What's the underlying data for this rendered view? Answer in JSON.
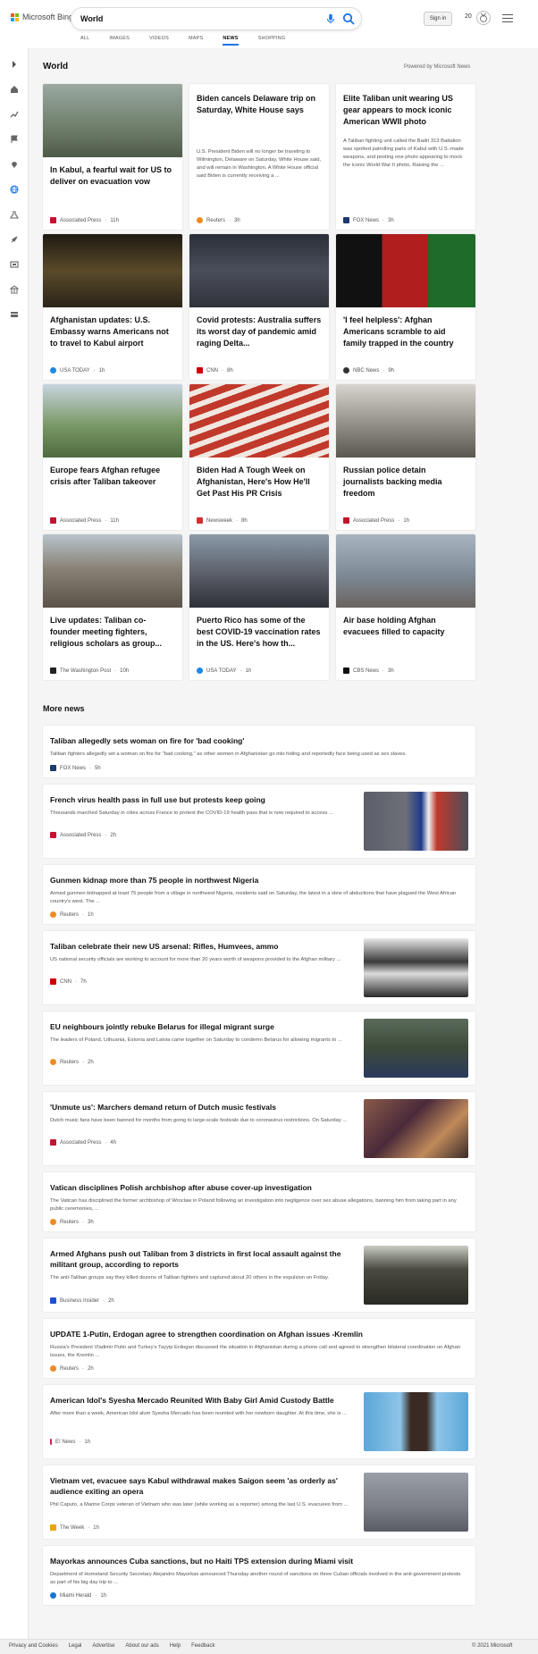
{
  "header": {
    "logo_text": "Microsoft Bing",
    "search_value": "World",
    "sign_in": "Sign in",
    "points": "20"
  },
  "scopes": [
    "ALL",
    "IMAGES",
    "VIDEOS",
    "MAPS",
    "NEWS",
    "SHOPPING"
  ],
  "active_scope": "NEWS",
  "section": {
    "title": "World",
    "powered_by": "Powered by Microsoft News"
  },
  "cards": [
    {
      "title": "In Kabul, a fearful wait for US to deliver on evacuation vow",
      "snippet": "",
      "source": "Associated Press",
      "time": "11h",
      "img_color": "#7a8a78",
      "src_color": "#c41230"
    },
    {
      "title": "Biden cancels Delaware trip on Saturday, White House says",
      "snippet": "U.S. President Biden will no longer be traveling to Wilmington, Delaware on Saturday, White House said, and will remain in Washington. A White House official said Biden is currently receiving a ...",
      "source": "Reuters",
      "time": "3h",
      "img_color": "",
      "src_color": "#f08a24"
    },
    {
      "title": "Elite Taliban unit wearing US gear appears to mock iconic American WWII photo",
      "snippet": "A Taliban fighting unit called the Badri 313 Battalion was spotted patrolling parts of Kabul with U.S.-made weapons, and posting one photo appearing to mock the iconic World War II photo, Raising the ...",
      "source": "FOX News",
      "time": "3h",
      "img_color": "",
      "src_color": "#1c3a6e"
    },
    {
      "title": "Afghanistan updates: U.S. Embassy warns Americans not to travel to Kabul airport",
      "snippet": "",
      "source": "USA TODAY",
      "time": "1h",
      "img_color": "#3a3222",
      "src_color": "#1e88e5"
    },
    {
      "title": "Covid protests: Australia suffers its worst day of pandemic amid raging Delta...",
      "snippet": "",
      "source": "CNN",
      "time": "8h",
      "img_color": "#3b3f4a",
      "src_color": "#cc0000"
    },
    {
      "title": "'I feel helpless': Afghan Americans scramble to aid family trapped in the country",
      "snippet": "",
      "source": "NBC News",
      "time": "9h",
      "img_color": "#2a5a2e",
      "src_color": "#333333"
    },
    {
      "title": "Europe fears Afghan refugee crisis after Taliban takeover",
      "snippet": "",
      "source": "Associated Press",
      "time": "11h",
      "img_color": "#6f8a5a",
      "src_color": "#c41230"
    },
    {
      "title": "Biden Had A Tough Week on Afghanistan, Here's How He'll Get Past His PR Crisis",
      "snippet": "",
      "source": "Newsweek",
      "time": "8h",
      "img_color": "#b33a3a",
      "src_color": "#d32f2f"
    },
    {
      "title": "Russian police detain journalists backing media freedom",
      "snippet": "",
      "source": "Associated Press",
      "time": "1h",
      "img_color": "#8c8c8c",
      "src_color": "#c41230"
    },
    {
      "title": "Live updates: Taliban co-founder meeting fighters, religious scholars as group...",
      "snippet": "",
      "source": "The Washington Post",
      "time": "10h",
      "img_color": "#8a8478",
      "src_color": "#222222"
    },
    {
      "title": "Puerto Rico has some of the best COVID-19 vaccination rates in the US. Here's how th...",
      "snippet": "",
      "source": "USA TODAY",
      "time": "1h",
      "img_color": "#6a6e78",
      "src_color": "#1e88e5"
    },
    {
      "title": "Air base holding Afghan evacuees filled to capacity",
      "snippet": "",
      "source": "CBS News",
      "time": "3h",
      "img_color": "#8a94a0",
      "src_color": "#111111"
    }
  ],
  "more_news": {
    "title": "More news",
    "items": [
      {
        "title": "Taliban allegedly sets woman on fire for 'bad cooking'",
        "snippet": "Taliban fighters allegedly set a woman on fire for \"bad cooking,\" as other women in Afghanistan go into hiding and reportedly face being used as sex slaves.",
        "source": "FOX News",
        "time": "5h",
        "thumb": "",
        "src_color": "#1c3a6e"
      },
      {
        "title": "French virus health pass in full use but protests keep going",
        "snippet": "Thousands marched Saturday in cities across France to protest the COVID-19 health pass that is now required to access ...",
        "source": "Associated Press",
        "time": "2h",
        "thumb": "#5a5e6a",
        "src_color": "#c41230"
      },
      {
        "title": "Gunmen kidnap more than 75 people in northwest Nigeria",
        "snippet": "Armed gunmen kidnapped at least 75 people from a village in northwest Nigeria, residents said on Saturday, the latest in a slew of abductions that have plagued the West African country's west. The ...",
        "source": "Reuters",
        "time": "1h",
        "thumb": "",
        "src_color": "#f08a24"
      },
      {
        "title": "Taliban celebrate their new US arsenal: Rifles, Humvees, ammo",
        "snippet": "US national security officials are working to account for more than 20 years worth of weapons provided to the Afghan military ...",
        "source": "CNN",
        "time": "7h",
        "thumb": "#3a3a3a",
        "src_color": "#cc0000"
      },
      {
        "title": "EU neighbours jointly rebuke Belarus for illegal migrant surge",
        "snippet": "The leaders of Poland, Lithuania, Estonia and Latvia came together on Saturday to condemn Belarus for allowing migrants to ...",
        "source": "Reuters",
        "time": "2h",
        "thumb": "#3d4a3a",
        "src_color": "#f08a24"
      },
      {
        "title": "'Unmute us': Marchers demand return of Dutch music festivals",
        "snippet": "Dutch music fans have been banned for months from going to large-scale festivals due to coronavirus restrictions. On Saturday ...",
        "source": "Associated Press",
        "time": "4h",
        "thumb": "#6a3a3a",
        "src_color": "#c41230"
      },
      {
        "title": "Vatican disciplines Polish archbishop after abuse cover-up investigation",
        "snippet": "The Vatican has disciplined the former archbishop of Wroclaw in Poland following an investigation into negligence over sex abuse allegations, banning him from taking part in any public ceremonies, ...",
        "source": "Reuters",
        "time": "3h",
        "thumb": "",
        "src_color": "#f08a24"
      },
      {
        "title": "Armed Afghans push out Taliban from 3 districts in first local assault against the militant group, according to reports",
        "snippet": "The anti-Taliban groups say they killed dozens of Taliban fighters and captured about 20 others in the expulsion on Friday.",
        "source": "Business Insider",
        "time": "2h",
        "thumb": "#4a4a40",
        "src_color": "#1d4fd8"
      },
      {
        "title": "UPDATE 1-Putin, Erdogan agree to strengthen coordination on Afghan issues -Kremlin",
        "snippet": "Russia's President Vladimir Putin and Turkey's Tayyip Erdogan discussed the situation in Afghanistan during a phone call and agreed to strengthen bilateral coordination on Afghan issues, the Kremlin ...",
        "source": "Reuters",
        "time": "2h",
        "thumb": "",
        "src_color": "#f08a24"
      },
      {
        "title": "American Idol's Syesha Mercado Reunited With Baby Girl Amid Custody Battle",
        "snippet": "After more than a week, American Idol alum Syesha Mercado has been reunited with her newborn daughter. At this time, she is ...",
        "source": "E! News",
        "time": "1h",
        "thumb": "#5aa7d8",
        "src_color": "#d81b60"
      },
      {
        "title": "Vietnam vet, evacuee says Kabul withdrawal makes Saigon seem 'as orderly as' audience exiting an opera",
        "snippet": "Phil Caputo, a Marine Corps veteran of Vietnam who was later (while working as a reporter) among the last U.S. evacuees from ...",
        "source": "The Week",
        "time": "1h",
        "thumb": "#7a7e84",
        "src_color": "#e8a500"
      },
      {
        "title": "Mayorkas announces Cuba sanctions, but no Haiti TPS extension during Miami visit",
        "snippet": "Department of Homeland Security Secretary Alejandro Mayorkas announced Thursday another round of sanctions on three Cuban officials involved in the anti-government protests as part of his big day trip to ...",
        "source": "Miami Herald",
        "time": "1h",
        "thumb": "",
        "src_color": "#1976d2"
      }
    ]
  },
  "footer": {
    "links": [
      "Privacy and Cookies",
      "Legal",
      "Advertise",
      "About our ads",
      "Help",
      "Feedback"
    ],
    "copyright": "© 2021 Microsoft"
  },
  "icons": {
    "sidebar": [
      "chevron-right-icon",
      "home-icon",
      "trending-icon",
      "flag-icon",
      "location-icon",
      "globe-icon",
      "science-icon",
      "rocket-icon",
      "entertainment-icon",
      "business-icon",
      "money-icon"
    ]
  },
  "colors": {
    "accent": "#1a73e8",
    "active_sidebar": "#1a73e8"
  }
}
